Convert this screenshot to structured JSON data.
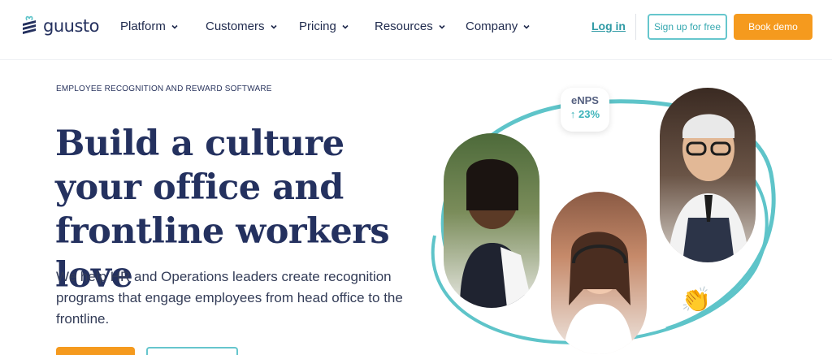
{
  "brand": {
    "name": "guusto"
  },
  "nav": {
    "items": [
      {
        "label": "Platform"
      },
      {
        "label": "Customers"
      },
      {
        "label": "Pricing"
      },
      {
        "label": "Resources"
      },
      {
        "label": "Company"
      }
    ],
    "login_label": "Log in",
    "signup_label": "Sign up for free",
    "demo_label": "Book demo"
  },
  "hero": {
    "eyebrow": "EMPLOYEE RECOGNITION AND REWARD SOFTWARE",
    "headline": "Build a culture your office and frontline workers love",
    "subtext": "We help HR and Operations leaders create recognition programs that engage employees from head office to the frontline."
  },
  "badge": {
    "label": "eNPS",
    "value": "↑ 23%"
  },
  "icons": {
    "clap": "clapping-hands-icon",
    "chevron": "chevron-down-icon"
  },
  "colors": {
    "accent": "#f59a1e",
    "teal": "#3bb3b9",
    "navy": "#24315f"
  }
}
